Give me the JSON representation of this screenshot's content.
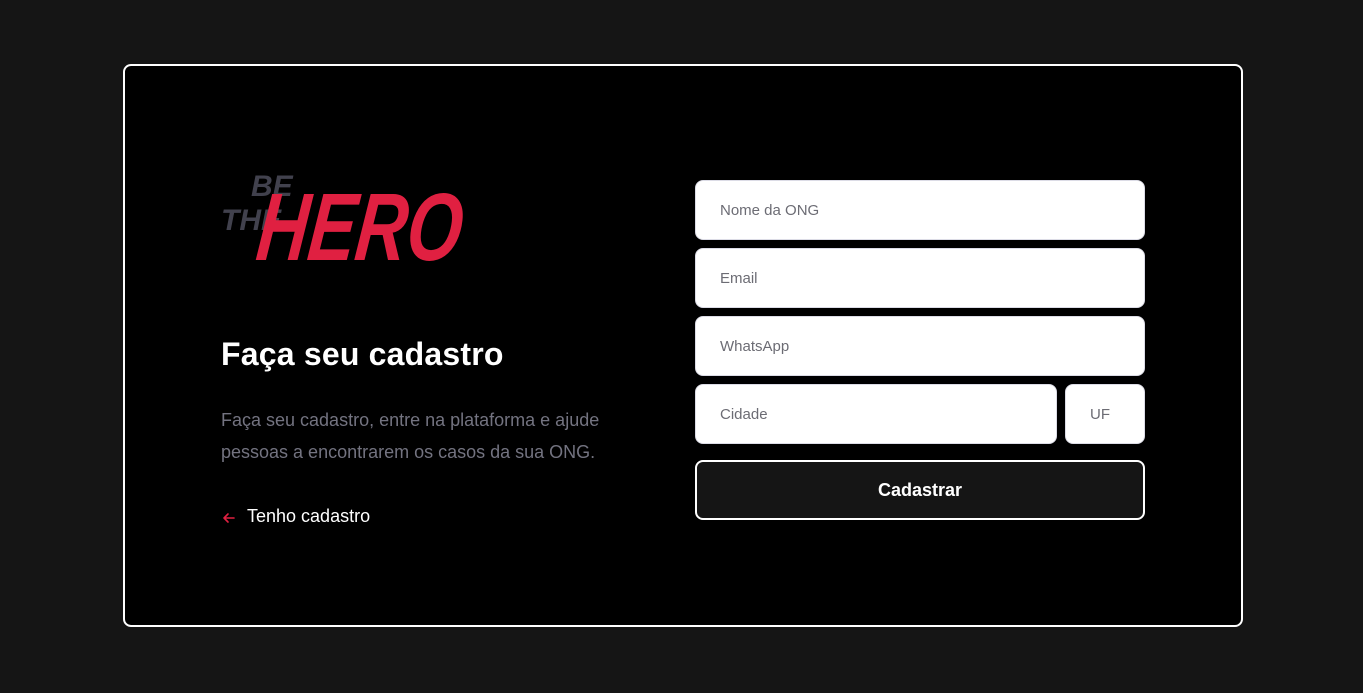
{
  "logo": {
    "line1": "BE",
    "line2": "THE",
    "line3": "HERO",
    "colors": {
      "small": "#41414d",
      "big": "#e02041"
    }
  },
  "left": {
    "title": "Faça seu cadastro",
    "description": "Faça seu cadastro, entre na plataforma e ajude pessoas a encontrarem os casos da sua ONG.",
    "back_link_label": "Tenho cadastro",
    "back_icon": "arrow-left-icon"
  },
  "form": {
    "name_placeholder": "Nome da ONG",
    "email_placeholder": "Email",
    "whatsapp_placeholder": "WhatsApp",
    "city_placeholder": "Cidade",
    "uf_placeholder": "UF",
    "submit_label": "Cadastrar"
  },
  "colors": {
    "page_bg": "#151515",
    "card_bg": "#000000",
    "accent": "#e02041",
    "muted_text": "#737380"
  }
}
